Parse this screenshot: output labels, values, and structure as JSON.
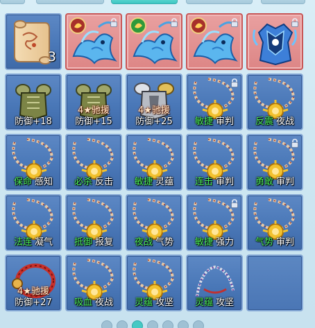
{
  "inventory": {
    "slots": [
      {
        "type": "scroll",
        "count": "3"
      },
      {
        "type": "fish",
        "bg": "red",
        "locked": true,
        "badge": "red"
      },
      {
        "type": "fish",
        "bg": "red",
        "locked": true,
        "badge": "green"
      },
      {
        "type": "fish",
        "bg": "red",
        "locked": true,
        "badge": "red"
      },
      {
        "type": "armor-blue",
        "bg": "red",
        "locked": true
      },
      {
        "type": "armor",
        "label": "防御+18"
      },
      {
        "type": "armor",
        "star": "4★驰援",
        "label": "防御+15"
      },
      {
        "type": "armor-silver",
        "star": "4★驰援",
        "label": "防御+25"
      },
      {
        "type": "necklace",
        "k": "敏捷",
        "w": "审判",
        "locked": true
      },
      {
        "type": "necklace",
        "k": "反震",
        "w": "夜战"
      },
      {
        "type": "necklace",
        "k": "保命",
        "w": "感知"
      },
      {
        "type": "necklace",
        "k": "必杀",
        "w": "反击"
      },
      {
        "type": "necklace",
        "k": "敏捷",
        "w": "灵蕴"
      },
      {
        "type": "necklace",
        "k": "连击",
        "w": "审判"
      },
      {
        "type": "necklace",
        "k": "勇敢",
        "w": "审判",
        "locked": true
      },
      {
        "type": "necklace",
        "k": "法连",
        "w": "凝气"
      },
      {
        "type": "necklace",
        "k": "抵御",
        "w": "报复"
      },
      {
        "type": "necklace",
        "k": "夜战",
        "w": "气势"
      },
      {
        "type": "necklace",
        "k": "敏捷",
        "w": "强力",
        "locked": true
      },
      {
        "type": "necklace",
        "k": "气势",
        "w": "审判"
      },
      {
        "type": "bracelet",
        "star": "4★驰援",
        "label": "防御+27"
      },
      {
        "type": "necklace",
        "k": "吸血",
        "w": "夜战"
      },
      {
        "type": "necklace",
        "k": "灵蕴",
        "w": "攻坚"
      },
      {
        "type": "chain",
        "k": "灵蕴",
        "w": "攻坚"
      },
      {
        "type": "empty"
      }
    ]
  },
  "colors": {
    "slot_blue": "#4a78b8",
    "slot_red": "#dd8686",
    "skill_green": "#4cf05a",
    "page_dot_active": "#45c9c4"
  },
  "pagination": {
    "pages": 7,
    "current": 3
  }
}
